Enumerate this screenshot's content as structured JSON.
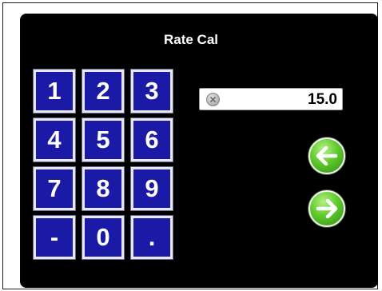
{
  "title": "Rate Cal",
  "keypad": {
    "keys": [
      "1",
      "2",
      "3",
      "4",
      "5",
      "6",
      "7",
      "8",
      "9",
      "-",
      "0",
      "."
    ]
  },
  "display": {
    "value": "15.0",
    "clear_icon": "clear-x-icon"
  },
  "nav": {
    "back_icon": "arrow-left-icon",
    "forward_icon": "arrow-right-icon",
    "button_color": "#4cbf22"
  },
  "colors": {
    "panel_bg": "#000000",
    "key_bg": "#1a1aa6",
    "key_text": "#ffffff"
  }
}
